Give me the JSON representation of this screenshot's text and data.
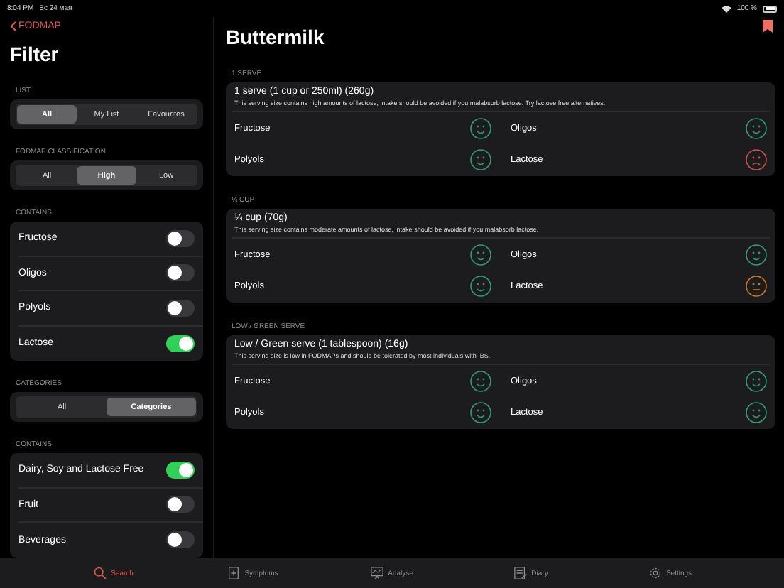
{
  "status_bar": {
    "time": "8:04 PM",
    "date": "Вс 24 мая",
    "battery": "100 %"
  },
  "sidebar": {
    "back": "FODMAP",
    "title": "Filter",
    "sections": [
      {
        "kind": "segments",
        "label": "LIST",
        "options": [
          {
            "label": "All",
            "selected": true
          },
          {
            "label": "My List",
            "selected": false
          },
          {
            "label": "Favourites",
            "selected": false
          }
        ]
      },
      {
        "kind": "segments",
        "label": "FODMAP CLASSIFICATION",
        "options": [
          {
            "label": "All",
            "selected": false
          },
          {
            "label": "High",
            "selected": true
          },
          {
            "label": "Low",
            "selected": false
          }
        ]
      },
      {
        "kind": "toggles",
        "label": "CONTAINS",
        "items": [
          {
            "label": "Fructose",
            "on": false
          },
          {
            "label": "Oligos",
            "on": false
          },
          {
            "label": "Polyols",
            "on": false
          },
          {
            "label": "Lactose",
            "on": true
          }
        ]
      },
      {
        "kind": "segments",
        "label": "CATEGORIES",
        "options": [
          {
            "label": "All",
            "selected": false
          },
          {
            "label": "Categories",
            "selected": true
          }
        ]
      },
      {
        "kind": "toggles",
        "label": "CONTAINS",
        "items": [
          {
            "label": "Dairy, Soy and Lactose Free",
            "on": true
          },
          {
            "label": "Fruit",
            "on": false
          },
          {
            "label": "Beverages",
            "on": false
          }
        ]
      }
    ]
  },
  "detail": {
    "title": "Buttermilk",
    "bookmarked": true,
    "serves": [
      {
        "label": "1 SERVE",
        "title": "1 serve (1 cup or 250ml) (260g)",
        "description": "This serving size contains high amounts of lactose, intake should be avoided if you malabsorb lactose. Try lactose free alternatives.",
        "ratings": [
          {
            "name": "Fructose",
            "kind": "low"
          },
          {
            "name": "Oligos",
            "kind": "low"
          },
          {
            "name": "Polyols",
            "kind": "low"
          },
          {
            "name": "Lactose",
            "kind": "high"
          }
        ]
      },
      {
        "label": "¼ CUP",
        "title": "¼ cup (70g)",
        "description": "This serving size contains moderate amounts of lactose, intake should be avoided if you malabsorb lactose.",
        "ratings": [
          {
            "name": "Fructose",
            "kind": "low"
          },
          {
            "name": "Oligos",
            "kind": "low"
          },
          {
            "name": "Polyols",
            "kind": "low"
          },
          {
            "name": "Lactose",
            "kind": "moderate"
          }
        ]
      },
      {
        "label": "LOW / GREEN SERVE",
        "title": "Low / Green serve (1 tablespoon) (16g)",
        "description": "This serving size is low in FODMAPs and should be tolerated by most individuals with IBS.",
        "ratings": [
          {
            "name": "Fructose",
            "kind": "low"
          },
          {
            "name": "Oligos",
            "kind": "low"
          },
          {
            "name": "Polyols",
            "kind": "low"
          },
          {
            "name": "Lactose",
            "kind": "low"
          }
        ]
      }
    ]
  },
  "tab_bar": [
    {
      "label": "Search",
      "kind": "search",
      "selected": true
    },
    {
      "label": "Symptoms",
      "kind": "symptoms",
      "selected": false
    },
    {
      "label": "Analyse",
      "kind": "analyse",
      "selected": false
    },
    {
      "label": "Diary",
      "kind": "diary",
      "selected": false
    },
    {
      "label": "Settings",
      "kind": "settings",
      "selected": false
    }
  ]
}
